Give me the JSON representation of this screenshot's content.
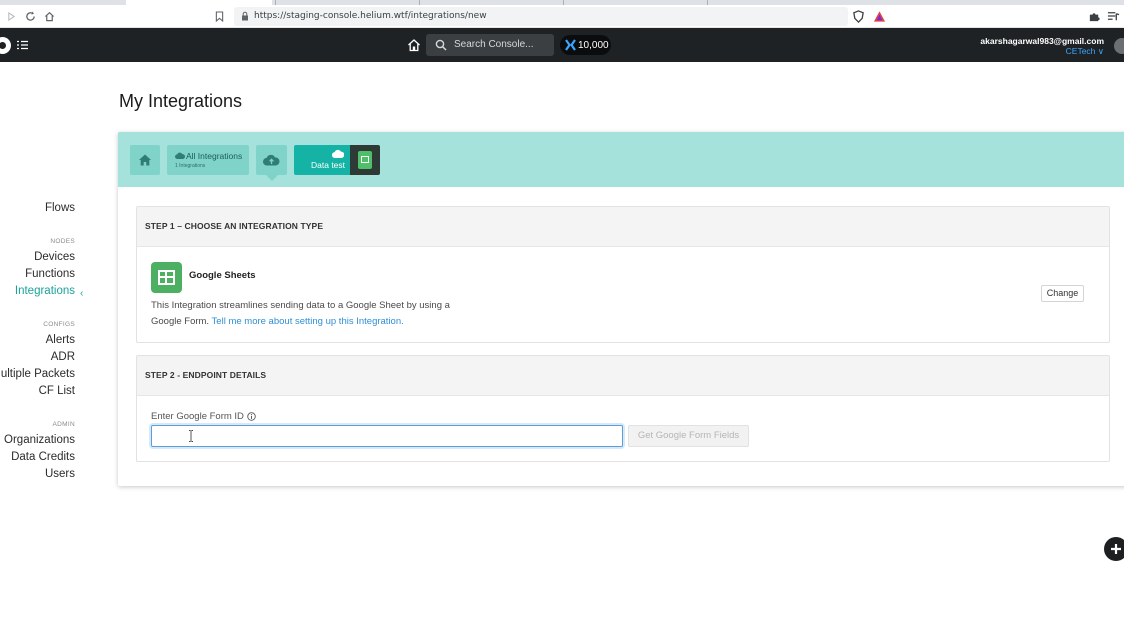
{
  "browser": {
    "url": "https://staging-console.helium.wtf/integrations/new"
  },
  "topnav": {
    "search_placeholder": "Search Console...",
    "credits": "10,000",
    "user_email": "akarshagarwal983@gmail.com",
    "org_name": "CETech ∨"
  },
  "sidebar": {
    "flows": "Flows",
    "nodes_header": "NODES",
    "devices": "Devices",
    "functions": "Functions",
    "integrations": "Integrations",
    "active_chevron": "‹",
    "configs_header": "CONFIGS",
    "alerts": "Alerts",
    "adr": "ADR",
    "multiple_packets": "Multiple Packets",
    "cf_list": "CF List",
    "admin_header": "ADMIN",
    "organizations": "Organizations",
    "data_credits": "Data Credits",
    "users": "Users"
  },
  "page": {
    "title": "My Integrations"
  },
  "breadcrumbs": {
    "all_integrations": "All Integrations",
    "integration_count": "1 Integrations",
    "current_name": "Data test"
  },
  "step1": {
    "heading": "STEP 1 – CHOOSE AN INTEGRATION TYPE",
    "integration_name": "Google Sheets",
    "description": "This Integration streamlines sending data to a Google Sheet by using a Google Form.",
    "link_text": "Tell me more about setting up this Integration.",
    "change_label": "Change"
  },
  "step2": {
    "heading": "STEP 2 - ENDPOINT DETAILS",
    "field_label": "Enter Google Form ID",
    "input_value": "",
    "get_fields_label": "Get Google Form Fields"
  },
  "colors": {
    "teal_band": "#a5e2dc",
    "teal_active": "#14b3a5",
    "accent_text": "#1aa39a",
    "link": "#2f8fd6",
    "nav_bg": "#1f2224"
  },
  "icons": [
    "back-icon",
    "reload-icon",
    "home-icon",
    "bookmark-icon",
    "lock-icon",
    "shield-icon",
    "triangle-icon",
    "puzzle-icon",
    "playlist-icon",
    "helium-logo-icon",
    "menu-icon",
    "search-icon",
    "credits-icon",
    "cloud-icon",
    "google-sheets-icon",
    "info-icon",
    "plus-icon"
  ]
}
